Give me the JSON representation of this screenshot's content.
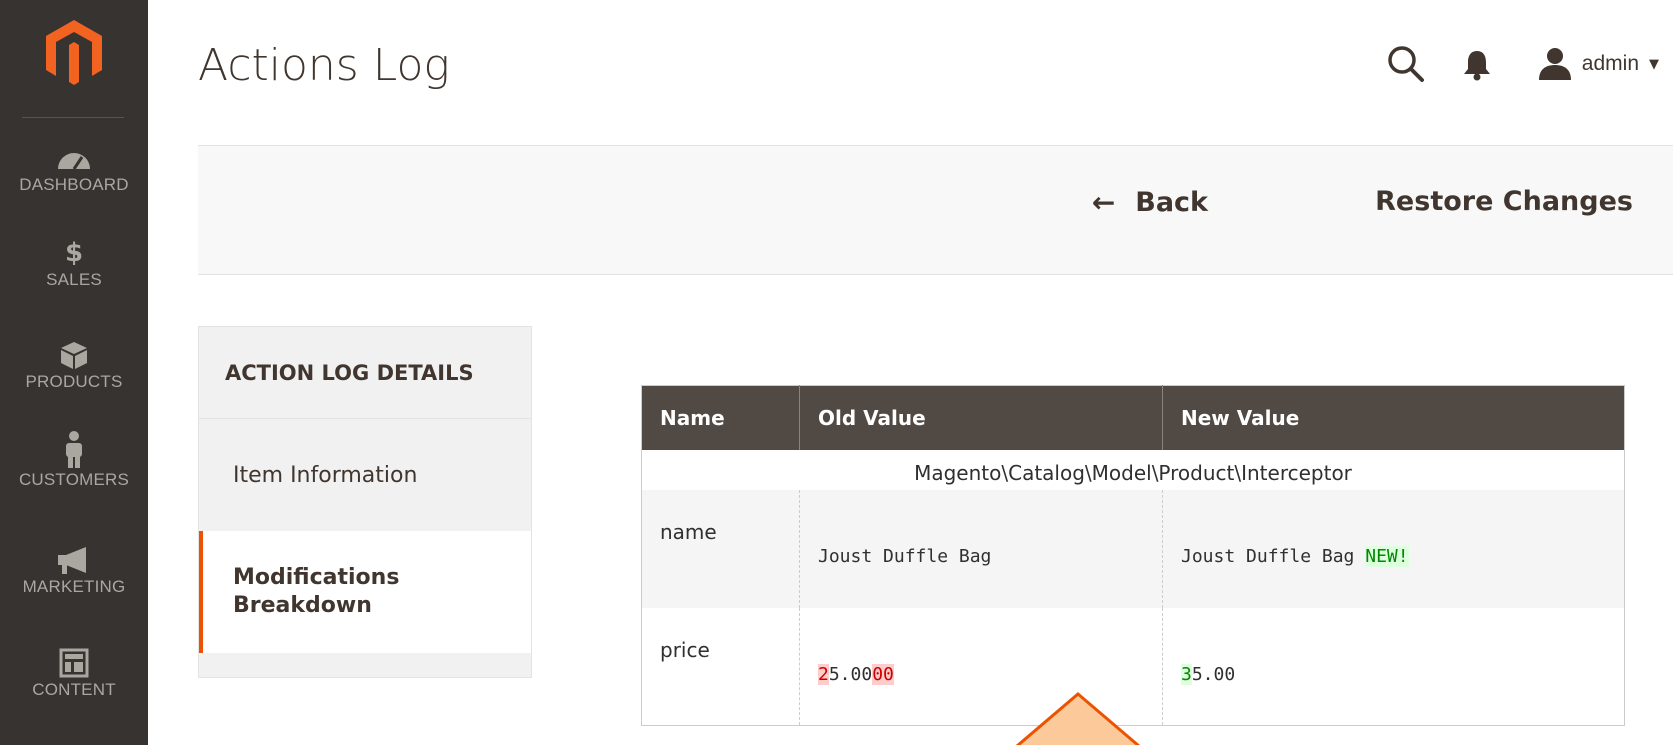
{
  "sidebar": {
    "items": [
      {
        "label": "DASHBOARD",
        "icon": "dashboard-icon"
      },
      {
        "label": "SALES",
        "icon": "dollar-icon"
      },
      {
        "label": "PRODUCTS",
        "icon": "cube-icon"
      },
      {
        "label": "CUSTOMERS",
        "icon": "person-icon"
      },
      {
        "label": "MARKETING",
        "icon": "megaphone-icon"
      },
      {
        "label": "CONTENT",
        "icon": "layout-icon"
      }
    ]
  },
  "header": {
    "title": "Actions Log",
    "user": "admin"
  },
  "actions": {
    "back_label": "Back",
    "restore_label": "Restore Changes"
  },
  "tabs": {
    "heading": "ACTION LOG DETAILS",
    "items": [
      {
        "label": "Item Information",
        "active": false
      },
      {
        "label": "Modifications Breakdown",
        "active": true
      }
    ]
  },
  "table": {
    "headers": [
      "Name",
      "Old Value",
      "New Value"
    ],
    "class_name": "Magento\\Catalog\\Model\\Product\\Interceptor",
    "rows": [
      {
        "name": "name",
        "old": [
          {
            "text": "Joust Duffle Bag",
            "type": "same"
          }
        ],
        "new": [
          {
            "text": "Joust Duffle Bag ",
            "type": "same"
          },
          {
            "text": "NEW!",
            "type": "ins"
          }
        ]
      },
      {
        "name": "price",
        "old": [
          {
            "text": "2",
            "type": "del"
          },
          {
            "text": "5.00",
            "type": "same"
          },
          {
            "text": "00",
            "type": "del"
          }
        ],
        "new": [
          {
            "text": "3",
            "type": "ins"
          },
          {
            "text": "5.00",
            "type": "same"
          }
        ]
      }
    ]
  },
  "colors": {
    "sidebar_bg": "#373330",
    "accent": "#eb5202",
    "table_header_bg": "#514943",
    "diff_delete": "#ffcccc",
    "diff_insert": "#ddffdd"
  }
}
